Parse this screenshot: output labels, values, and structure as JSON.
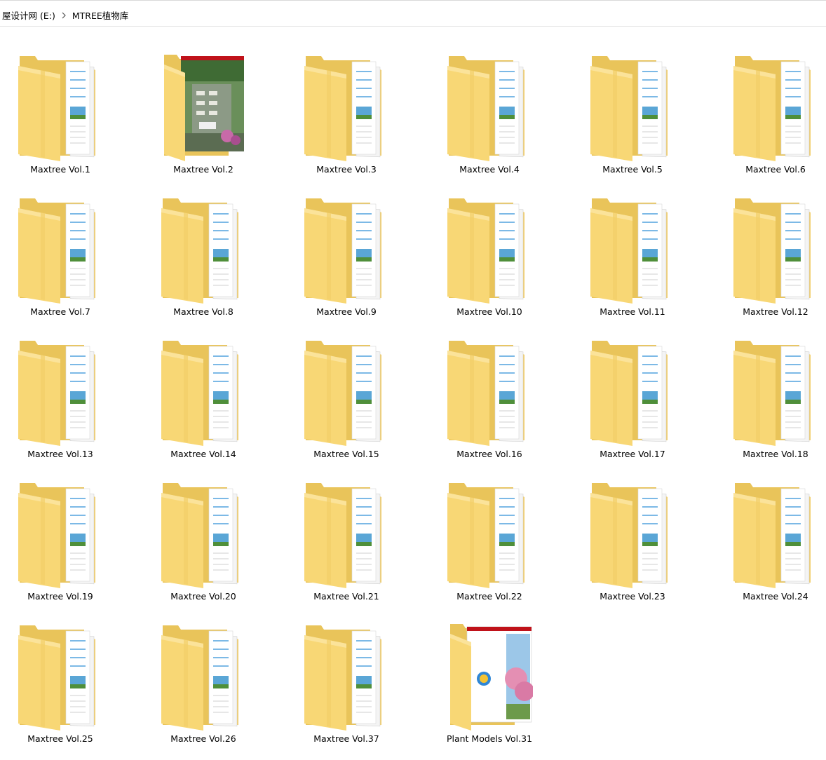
{
  "breadcrumb": {
    "drive": "屋设计网 (E:)",
    "folder": "MTREE植物库"
  },
  "icons": {
    "separator": "chevron-right-icon",
    "folder": "folder-icon"
  },
  "colors": {
    "folder_back": "#e9c45a",
    "folder_front": "#f8d775",
    "folder_shade": "#f2ce68",
    "paper": "#ffffff",
    "paper_line": "#2f8fd8",
    "photo_sky": "#5aa6d6",
    "photo_ground": "#4f8f3a"
  },
  "folders": [
    {
      "name": "Maxtree Vol.1",
      "preview": "doc"
    },
    {
      "name": "Maxtree Vol.2",
      "preview": "garden"
    },
    {
      "name": "Maxtree Vol.3",
      "preview": "doc"
    },
    {
      "name": "Maxtree Vol.4",
      "preview": "doc"
    },
    {
      "name": "Maxtree Vol.5",
      "preview": "doc"
    },
    {
      "name": "Maxtree Vol.6",
      "preview": "doc"
    },
    {
      "name": "Maxtree Vol.7",
      "preview": "doc"
    },
    {
      "name": "Maxtree Vol.8",
      "preview": "doc"
    },
    {
      "name": "Maxtree Vol.9",
      "preview": "doc"
    },
    {
      "name": "Maxtree Vol.10",
      "preview": "doc"
    },
    {
      "name": "Maxtree Vol.11",
      "preview": "doc"
    },
    {
      "name": "Maxtree Vol.12",
      "preview": "doc"
    },
    {
      "name": "Maxtree Vol.13",
      "preview": "doc"
    },
    {
      "name": "Maxtree Vol.14",
      "preview": "doc"
    },
    {
      "name": "Maxtree Vol.15",
      "preview": "doc"
    },
    {
      "name": "Maxtree Vol.16",
      "preview": "doc"
    },
    {
      "name": "Maxtree Vol.17",
      "preview": "doc"
    },
    {
      "name": "Maxtree Vol.18",
      "preview": "doc"
    },
    {
      "name": "Maxtree Vol.19",
      "preview": "doc"
    },
    {
      "name": "Maxtree Vol.20",
      "preview": "doc"
    },
    {
      "name": "Maxtree Vol.21",
      "preview": "doc"
    },
    {
      "name": "Maxtree Vol.22",
      "preview": "doc"
    },
    {
      "name": "Maxtree Vol.23",
      "preview": "doc"
    },
    {
      "name": "Maxtree Vol.24",
      "preview": "doc"
    },
    {
      "name": "Maxtree Vol.25",
      "preview": "doc"
    },
    {
      "name": "Maxtree Vol.26",
      "preview": "doc"
    },
    {
      "name": "Maxtree Vol.37",
      "preview": "doc"
    },
    {
      "name": "Plant Models Vol.31",
      "preview": "blossom"
    }
  ]
}
